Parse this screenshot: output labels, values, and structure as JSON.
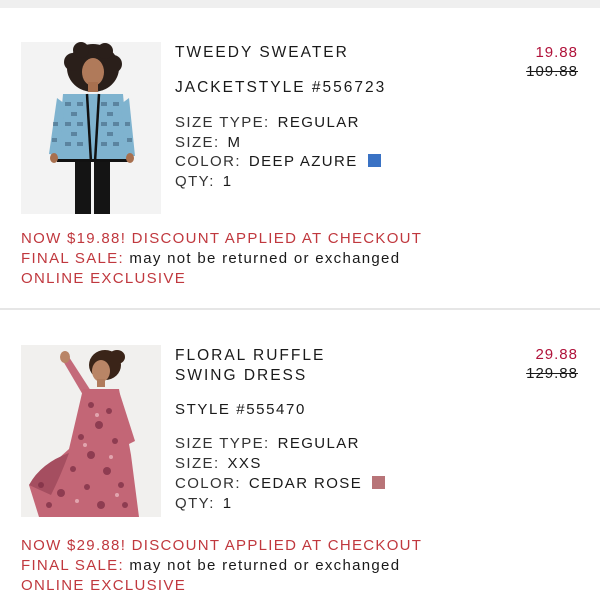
{
  "items": [
    {
      "title": "TWEEDY SWEATER JACKET",
      "title_line1": "TWEEDY SWEATER",
      "title_line2": "JACKET",
      "style": "STYLE #556723",
      "size_type_label": "SIZE TYPE:",
      "size_type": "REGULAR",
      "size_label": "SIZE:",
      "size": "M",
      "color_label": "COLOR:",
      "color": "DEEP AZURE",
      "color_swatch": "#3a72c4",
      "qty_label": "QTY:",
      "qty": "1",
      "sale_price": "19.88",
      "original_price": "109.88",
      "discount_note": "NOW $19.88! DISCOUNT APPLIED AT CHECKOUT",
      "final_sale_label": "FINAL SALE:",
      "final_sale_text": "may not be returned or exchanged",
      "exclusive": "ONLINE EXCLUSIVE"
    },
    {
      "title": "FLORAL RUFFLE SWING DRESS",
      "title_line1": "FLORAL RUFFLE",
      "title_line2": "SWING DRESS",
      "style": "STYLE #555470",
      "size_type_label": "SIZE TYPE:",
      "size_type": "REGULAR",
      "size_label": "SIZE:",
      "size": "XXS",
      "color_label": "COLOR:",
      "color": "CEDAR ROSE",
      "color_swatch": "#b87478",
      "qty_label": "QTY:",
      "qty": "1",
      "sale_price": "29.88",
      "original_price": "129.88",
      "discount_note": "NOW $29.88! DISCOUNT APPLIED AT CHECKOUT",
      "final_sale_label": "FINAL SALE:",
      "final_sale_text": "may not be returned or exchanged",
      "exclusive": "ONLINE EXCLUSIVE"
    }
  ],
  "colors": {
    "sale_red": "#b0123a",
    "note_red": "#c0383e"
  }
}
